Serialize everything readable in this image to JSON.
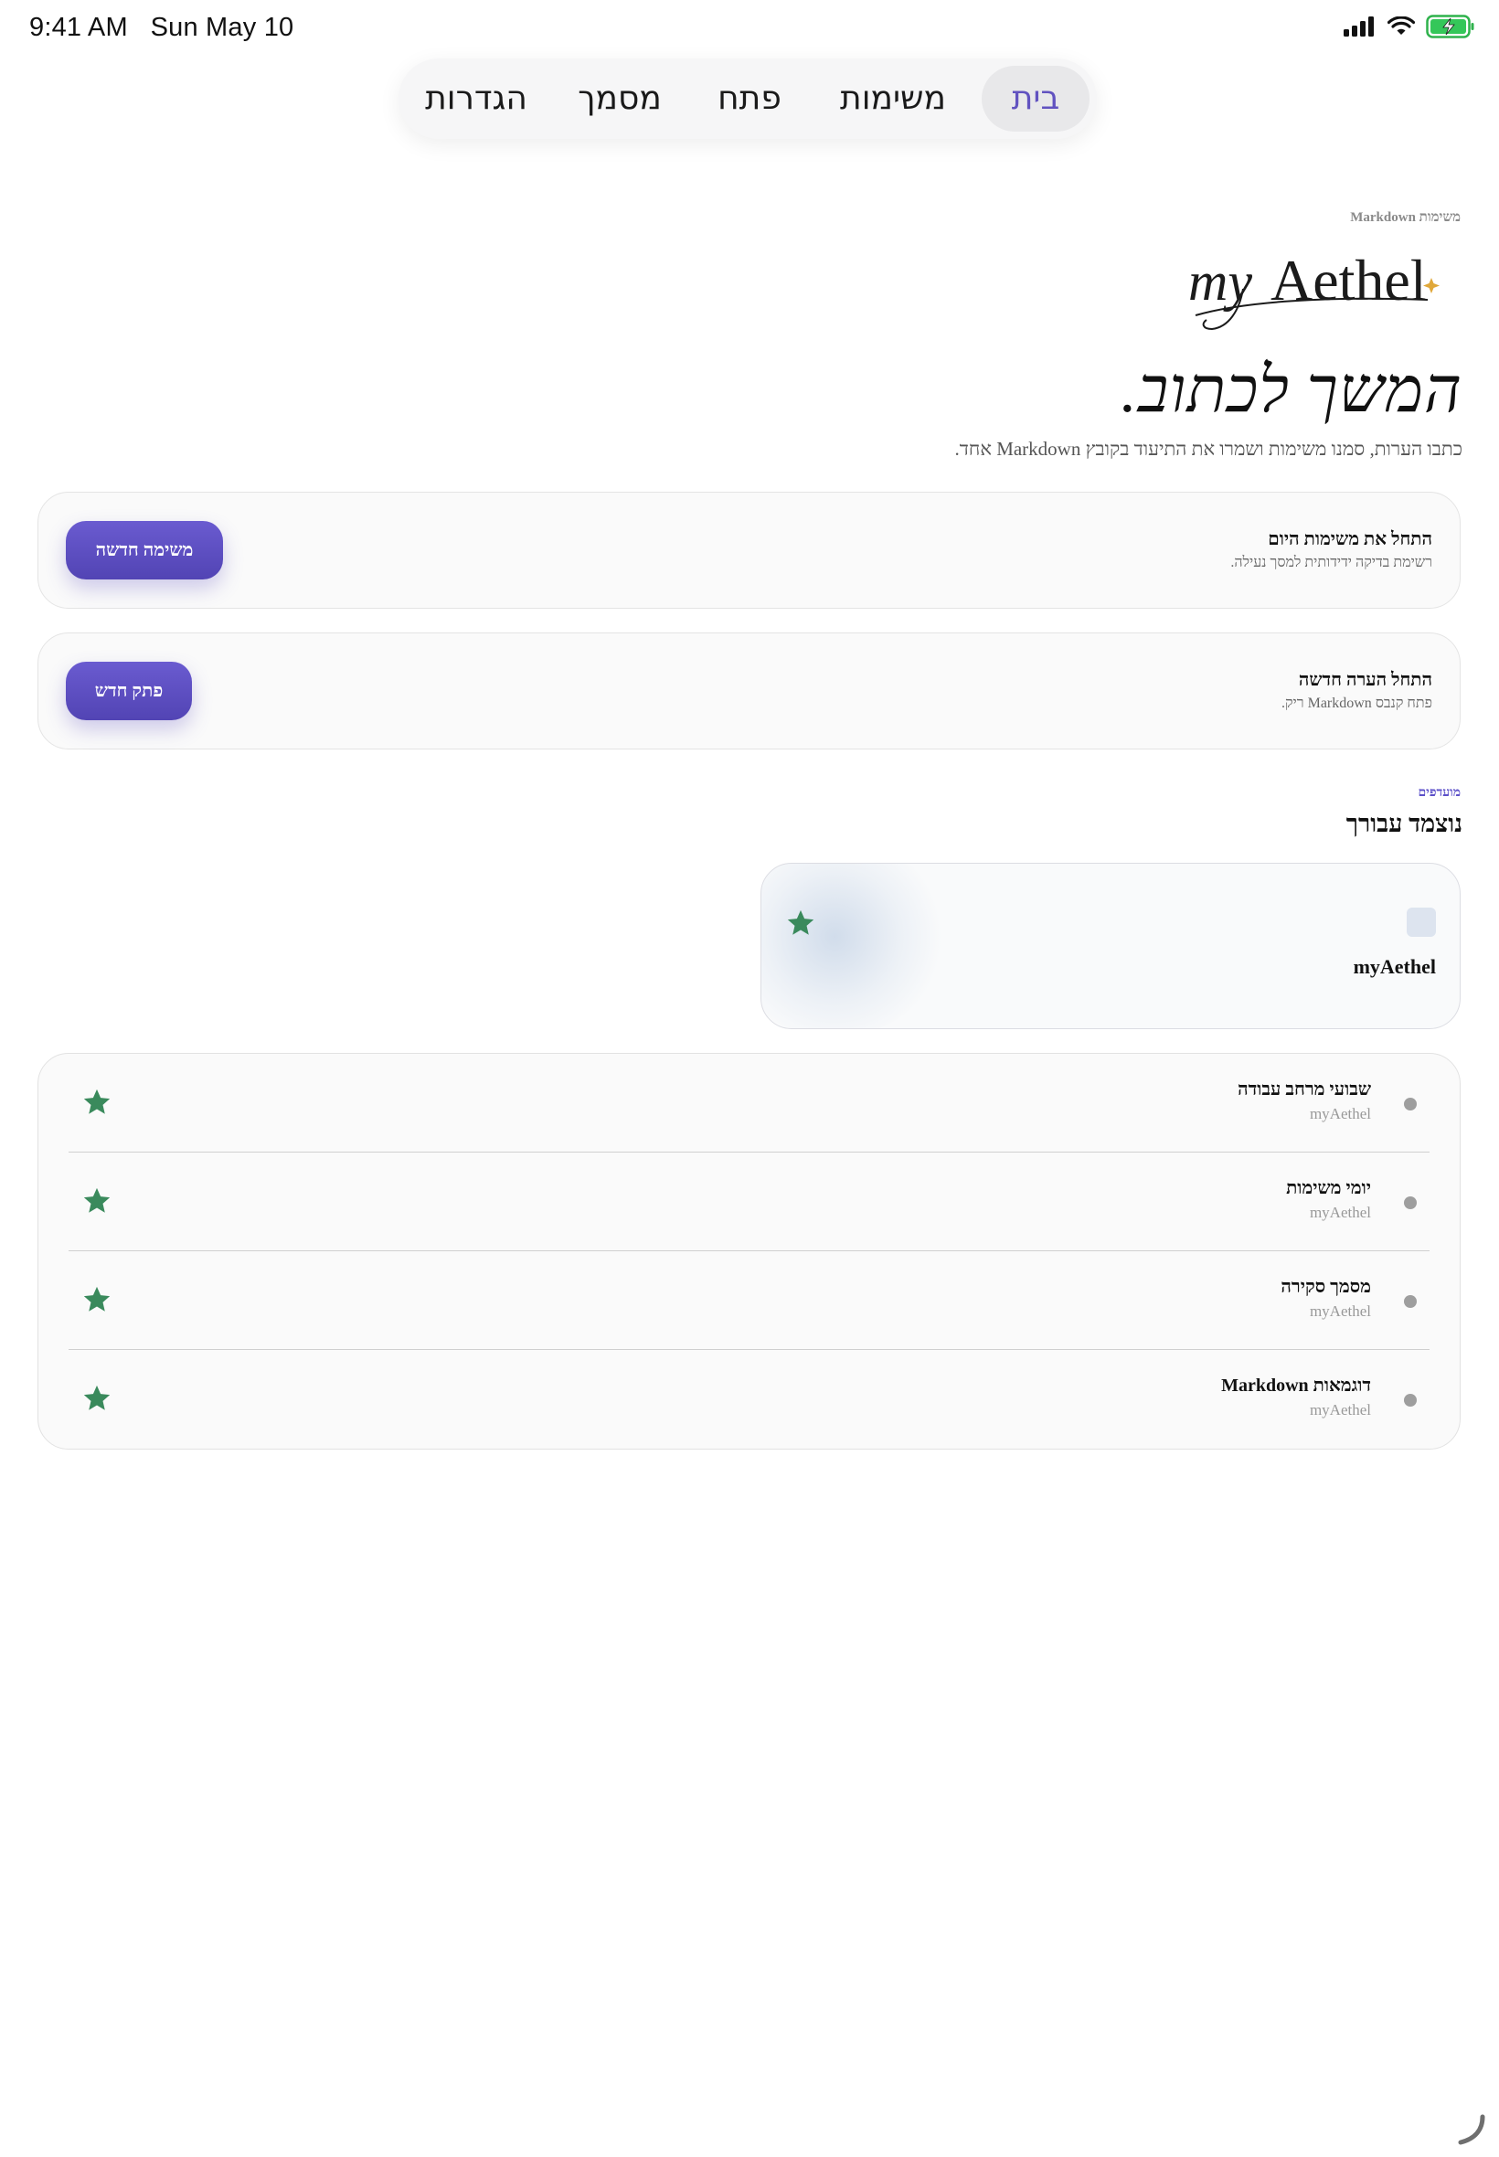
{
  "status_bar": {
    "time": "9:41 AM",
    "date": "Sun May 10",
    "icons": [
      "signal-icon",
      "wifi-icon",
      "battery-charging-icon"
    ]
  },
  "tabs": [
    {
      "label": "בית",
      "active": true
    },
    {
      "label": "משימות",
      "active": false
    },
    {
      "label": "פתח",
      "active": false
    },
    {
      "label": "מסמך",
      "active": false
    },
    {
      "label": "הגדרות",
      "active": false
    }
  ],
  "header": {
    "eyebrow": "משימות Markdown",
    "logo_text": "myAethel",
    "headline": "המשך לכתוב.",
    "subhead": "כתבו הערות, סמנו משימות ושמרו את התיעוד בקובץ Markdown אחד."
  },
  "actions": [
    {
      "title": "התחל את משימות היום",
      "subtitle": "רשימת בדיקה ידידותית למסך נעילה.",
      "button": "משימה חדשה"
    },
    {
      "title": "התחל הערה חדשה",
      "subtitle": "פתח קנבס Markdown ריק.",
      "button": "פתק חדש"
    }
  ],
  "favorites": {
    "eyebrow": "מועדפים",
    "title": "נוצמד עבורך",
    "featured": {
      "name": "myAethel"
    },
    "items": [
      {
        "title": "שבועי מרחב עבודה",
        "subtitle": "myAethel"
      },
      {
        "title": "יומי משימות",
        "subtitle": "myAethel"
      },
      {
        "title": "מסמך סקירה",
        "subtitle": "myAethel"
      },
      {
        "title": "דוגמאות Markdown",
        "subtitle": "myAethel"
      }
    ]
  },
  "colors": {
    "accent": "#5b4cc4",
    "star": "#3a8a5c",
    "logo_star": "#e0a83a"
  }
}
